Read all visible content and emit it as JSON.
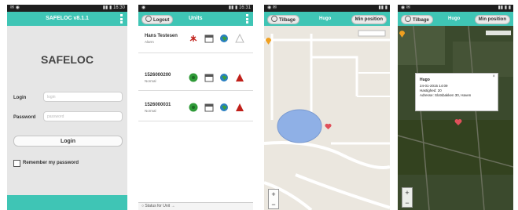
{
  "screen1": {
    "title": "SAFELOC v8.1.1",
    "brand": "SAFELOC",
    "login_label": "Login",
    "login_placeholder": "login",
    "password_label": "Password",
    "password_placeholder": "password",
    "login_button": "Login",
    "remember_label": "Remember my password"
  },
  "screen2": {
    "logout_button": "Logout",
    "title": "Units",
    "units": [
      {
        "name": "Hans Testesen",
        "sub": "Alarm"
      },
      {
        "name": "1526000200",
        "sub": "Normal"
      },
      {
        "name": "1526000031",
        "sub": "Normal"
      }
    ],
    "footer": "Status for Unit →"
  },
  "screen3": {
    "back_button": "Tilbage",
    "title": "Hugo",
    "position_button": "Min position"
  },
  "screen4": {
    "back_button": "Tilbage",
    "title": "Hugo",
    "position_button": "Min position",
    "popup": {
      "title": "Hugo",
      "lines": [
        "24-01-2015 14:09",
        "Hastighed: 20",
        "Adresse: Slotsbakken 30, Haven"
      ]
    }
  },
  "colors": {
    "accent": "#3fc5b5",
    "status_bar": "#1e1e1e",
    "alarm": "#c0201a"
  }
}
